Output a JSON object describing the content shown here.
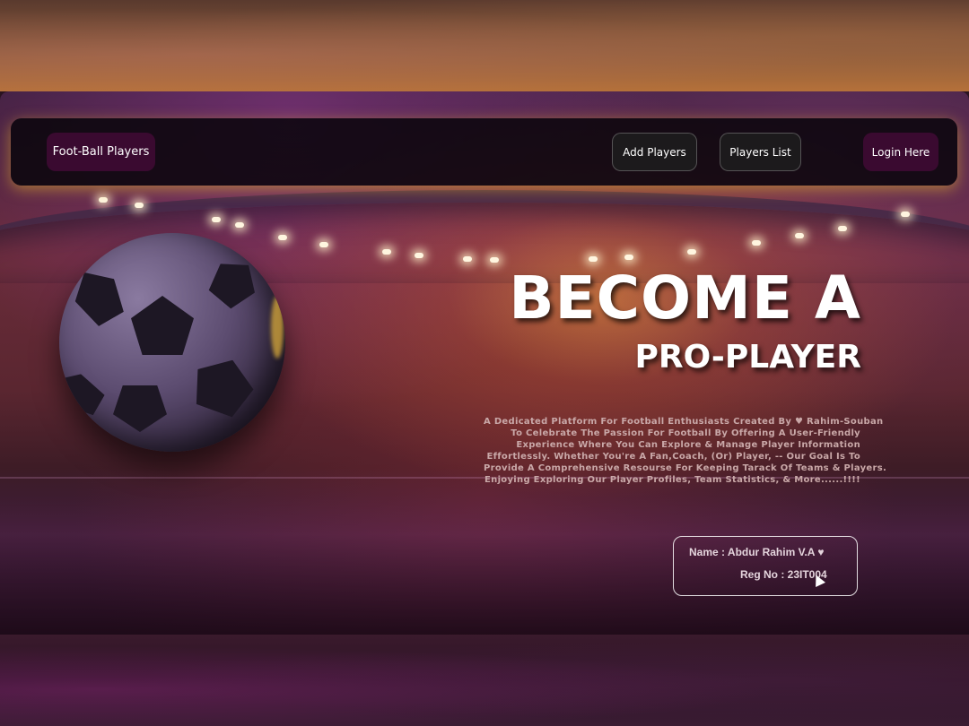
{
  "navbar": {
    "brand": "Foot-Ball Players",
    "add_players": "Add Players",
    "players_list": "Players List",
    "login": "Login Here"
  },
  "hero": {
    "title": "BECOME A",
    "subtitle": "PRO-PLAYER",
    "description_lines": [
      "A Dedicated Platform For Football Enthusiasts Created By ♥ Rahim-Souban",
      "To Celebrate The Passion For Football By Offering A User-Friendly",
      "Experience Where You Can Explore & Manage Player Information",
      "Effortlessly. Whether You're A Fan,Coach, (Or) Player, -- Our Goal Is To",
      "Provide A Comprehensive Resourse For Keeping Tarack Of Teams & Players.",
      "Enjoying Exploring Our Player Profiles, Team Statistics, & More......!!!!"
    ]
  },
  "info_card": {
    "name": "Name : Abdur Rahim V.A ♥",
    "reg_no": "Reg No : 23IT004"
  },
  "colors": {
    "navbar_bg": "#0a060c",
    "brand_bg": "#3a0a30",
    "nav_glow": "#e6b428",
    "text": "#ffffff"
  },
  "icons": {
    "ball": "soccer-ball-icon",
    "cursor": "mouse-cursor-icon"
  }
}
